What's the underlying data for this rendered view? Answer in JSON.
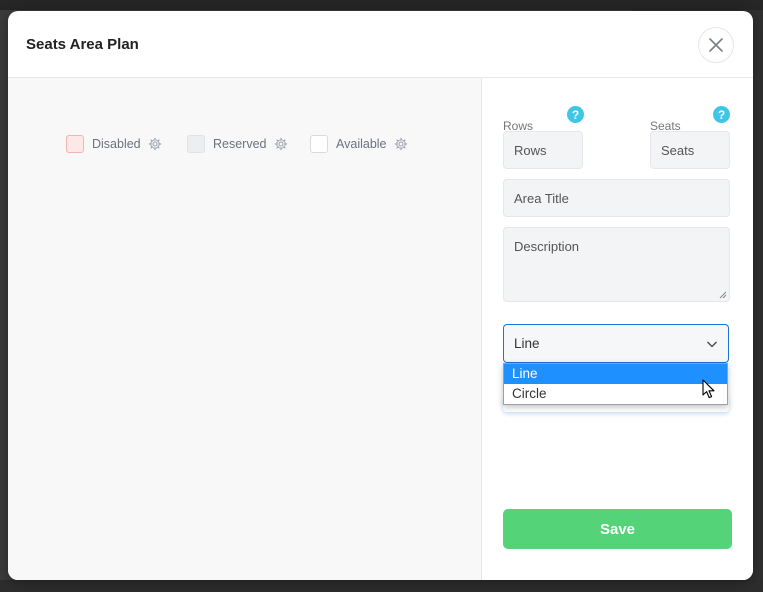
{
  "modal": {
    "title": "Seats Area Plan",
    "close_icon": "close-icon"
  },
  "legend": [
    {
      "label": "Disabled",
      "box_fill": "#fde8e8",
      "box_border": "#f5b3b3",
      "icon": "gear-icon"
    },
    {
      "label": "Reserved",
      "box_fill": "#eceef0",
      "box_border": "#e1e3e6",
      "icon": "gear-icon"
    },
    {
      "label": "Available",
      "box_fill": "#ffffff",
      "box_border": "#d8dadd",
      "icon": "gear-icon"
    }
  ],
  "form": {
    "rows_label": "Rows",
    "rows_placeholder": "Rows",
    "seats_label": "Seats",
    "seats_placeholder": "Seats",
    "help_glyph": "?",
    "area_title_placeholder": "Area Title",
    "description_placeholder": "Description",
    "shape_select": {
      "value": "Line",
      "options": [
        "Line",
        "Circle"
      ],
      "highlighted_option": "Line"
    },
    "save_label": "Save"
  },
  "colors": {
    "accent_blue": "#1d74d8",
    "help_cyan": "#3ec6e6",
    "save_green": "#55d378",
    "option_highlight": "#1e90ff"
  }
}
